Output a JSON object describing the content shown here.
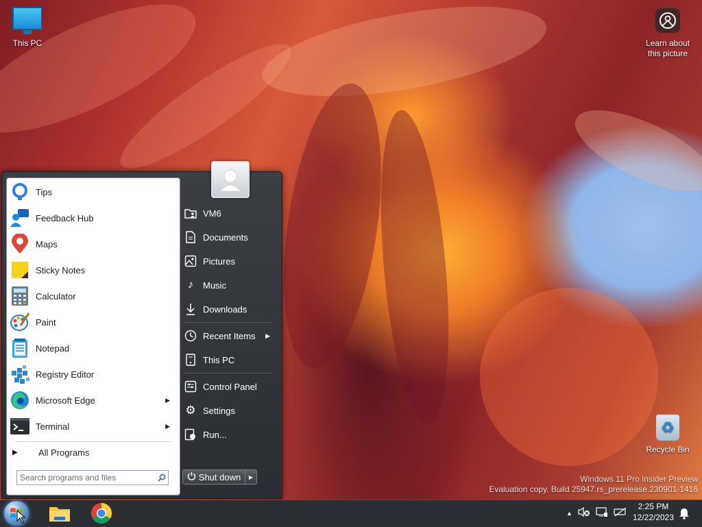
{
  "desktop": {
    "icons": {
      "this_pc": "This PC",
      "learn_line1": "Learn about",
      "learn_line2": "this picture",
      "recycle_bin": "Recycle Bin"
    },
    "watermark": {
      "line1": "Windows 11 Pro Insider Preview",
      "line2": "Evaluation copy. Build 25947.rs_prerelease.230901-1416"
    }
  },
  "start_menu": {
    "programs": [
      {
        "label": "Tips",
        "icon": "tips-icon"
      },
      {
        "label": "Feedback Hub",
        "icon": "feedback-hub-icon"
      },
      {
        "label": "Maps",
        "icon": "maps-icon"
      },
      {
        "label": "Sticky Notes",
        "icon": "sticky-notes-icon"
      },
      {
        "label": "Calculator",
        "icon": "calculator-icon"
      },
      {
        "label": "Paint",
        "icon": "paint-icon"
      },
      {
        "label": "Notepad",
        "icon": "notepad-icon"
      },
      {
        "label": "Registry Editor",
        "icon": "registry-editor-icon"
      },
      {
        "label": "Microsoft Edge",
        "icon": "edge-icon",
        "has_submenu": true
      },
      {
        "label": "Terminal",
        "icon": "terminal-icon",
        "has_submenu": true
      }
    ],
    "all_programs": "All Programs",
    "search_placeholder": "Search programs and files",
    "right_items": [
      {
        "label": "VM6",
        "icon": "user-folder-icon"
      },
      {
        "label": "Documents",
        "icon": "documents-icon"
      },
      {
        "label": "Pictures",
        "icon": "pictures-icon"
      },
      {
        "label": "Music",
        "icon": "music-icon"
      },
      {
        "label": "Downloads",
        "icon": "downloads-icon"
      },
      {
        "label": "Recent Items",
        "icon": "recent-items-icon",
        "has_submenu": true
      },
      {
        "label": "This PC",
        "icon": "this-pc-icon"
      },
      {
        "label": "Control Panel",
        "icon": "control-panel-icon"
      },
      {
        "label": "Settings",
        "icon": "settings-icon"
      },
      {
        "label": "Run...",
        "icon": "run-icon"
      }
    ],
    "shutdown_label": "Shut down"
  },
  "taskbar": {
    "apps": [
      "file-explorer-icon",
      "chrome-icon"
    ],
    "tray": [
      "show-hidden-icons-icon",
      "volume-muted-icon",
      "network-icon",
      "battery-icon",
      "notification-icon"
    ],
    "time": "2:25 PM",
    "date": "12/22/2023"
  },
  "colors": {
    "start_menu_bg": "#2b2e32",
    "taskbar_bg": "#2b2e32",
    "accent": "#1d5aa4"
  }
}
